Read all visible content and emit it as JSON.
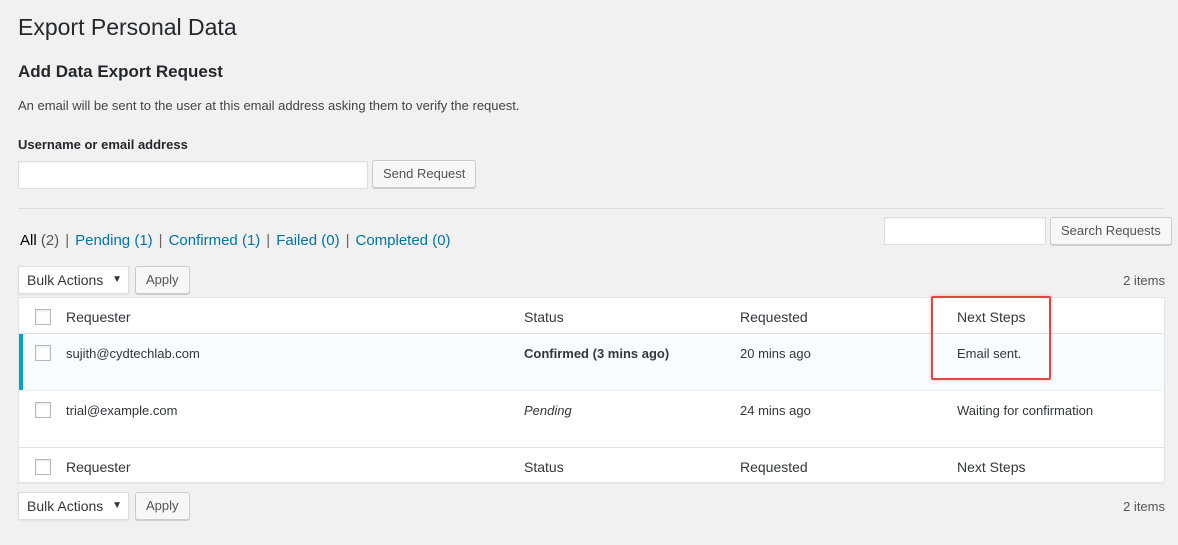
{
  "page": {
    "title": "Export Personal Data"
  },
  "add_request": {
    "heading": "Add Data Export Request",
    "description": "An email will be sent to the user at this email address asking them to verify the request.",
    "field_label": "Username or email address",
    "input_value": "",
    "send_button": "Send Request"
  },
  "filters": [
    {
      "label": "All",
      "count": "(2)",
      "current": true
    },
    {
      "label": "Pending",
      "count": "(1)",
      "current": false
    },
    {
      "label": "Confirmed",
      "count": "(1)",
      "current": false
    },
    {
      "label": "Failed",
      "count": "(0)",
      "current": false
    },
    {
      "label": "Completed",
      "count": "(0)",
      "current": false
    }
  ],
  "filter_separator": "|",
  "search": {
    "value": "",
    "button": "Search Requests"
  },
  "bulk": {
    "selected": "Bulk Actions",
    "apply": "Apply",
    "items_count": "2 items"
  },
  "table": {
    "columns": {
      "requester": "Requester",
      "status": "Status",
      "requested": "Requested",
      "next_steps": "Next Steps"
    },
    "rows": [
      {
        "requester": "sujith@cydtechlab.com",
        "status": "Confirmed (3 mins ago)",
        "requested": "20 mins ago",
        "next_steps": "Email sent."
      },
      {
        "requester": "trial@example.com",
        "status": "Pending",
        "requested": "24 mins ago",
        "next_steps": "Waiting for confirmation"
      }
    ]
  },
  "colors": {
    "link": "#0073aa",
    "active_row_border": "#00a0d2",
    "highlight": "#e0483f",
    "background": "#f1f1f1"
  }
}
